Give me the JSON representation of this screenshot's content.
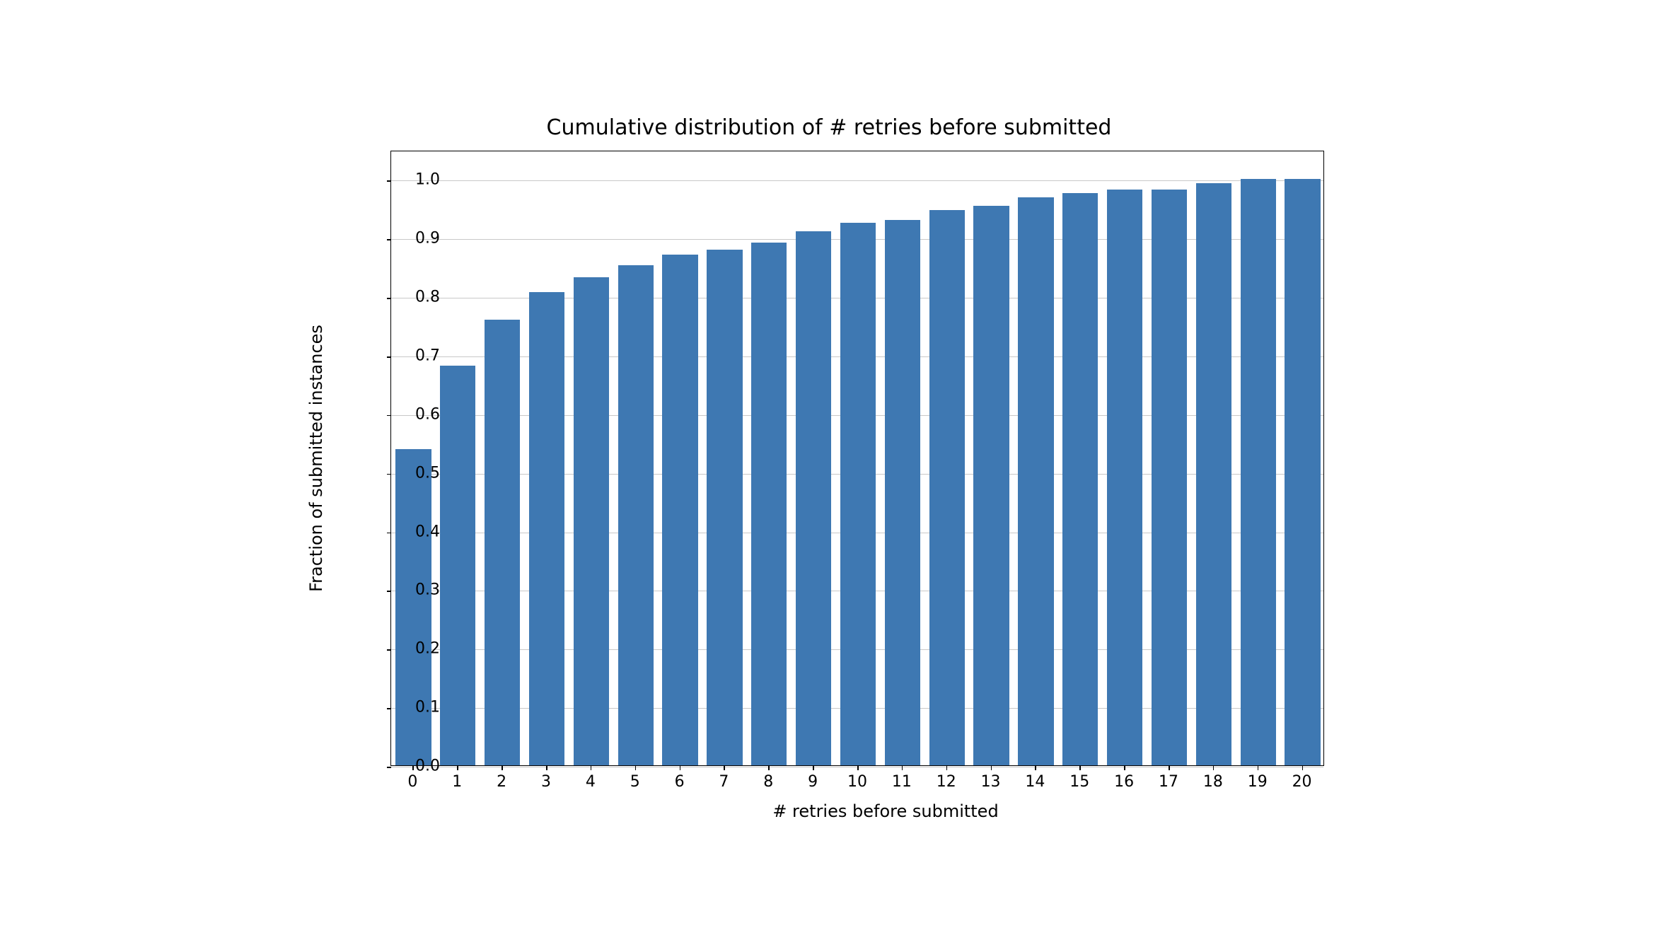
{
  "chart_data": {
    "type": "bar",
    "title": "Cumulative distribution of # retries before submitted",
    "xlabel": "# retries before submitted",
    "ylabel": "Fraction of submitted instances",
    "categories": [
      "0",
      "1",
      "2",
      "3",
      "4",
      "5",
      "6",
      "7",
      "8",
      "9",
      "10",
      "11",
      "12",
      "13",
      "14",
      "15",
      "16",
      "17",
      "18",
      "19",
      "20"
    ],
    "values": [
      0.54,
      0.682,
      0.76,
      0.807,
      0.833,
      0.853,
      0.872,
      0.88,
      0.892,
      0.911,
      0.926,
      0.93,
      0.947,
      0.955,
      0.969,
      0.977,
      0.983,
      0.983,
      0.993,
      1.0,
      1.0
    ],
    "ylim": [
      0.0,
      1.05
    ],
    "yticks": [
      0.0,
      0.1,
      0.2,
      0.3,
      0.4,
      0.5,
      0.6,
      0.7,
      0.8,
      0.9,
      1.0
    ],
    "ytick_labels": [
      "0.0",
      "0.1",
      "0.2",
      "0.3",
      "0.4",
      "0.5",
      "0.6",
      "0.7",
      "0.8",
      "0.9",
      "1.0"
    ],
    "bar_color": "#3e78b2",
    "grid": true
  }
}
